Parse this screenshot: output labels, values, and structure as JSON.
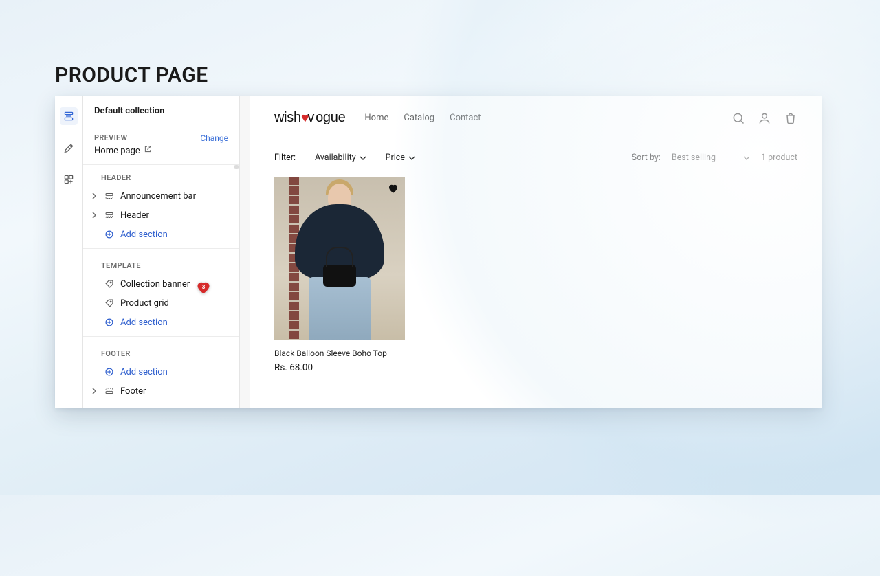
{
  "page_heading": "PRODUCT PAGE",
  "sidebar": {
    "title": "Default collection",
    "preview_label": "PREVIEW",
    "change_label": "Change",
    "home_page_label": "Home page",
    "groups": {
      "header": {
        "label": "HEADER",
        "items": [
          "Announcement bar",
          "Header"
        ],
        "add": "Add section"
      },
      "template": {
        "label": "TEMPLATE",
        "items": [
          "Collection banner",
          "Product grid"
        ],
        "add": "Add section"
      },
      "footer": {
        "label": "FOOTER",
        "add": "Add section",
        "items": [
          "Footer"
        ]
      }
    }
  },
  "store": {
    "logo_part1": "wish",
    "logo_part2": "ogue",
    "nav": {
      "home": "Home",
      "catalog": "Catalog",
      "contact": "Contact"
    },
    "filter": {
      "label": "Filter:",
      "availability": "Availability",
      "price": "Price",
      "sort_label": "Sort by:",
      "sort_value": "Best selling",
      "count": "1 product"
    },
    "product": {
      "name": "Black Balloon Sleeve Boho Top",
      "price": "Rs. 68.00"
    }
  },
  "wishlist_badge": "3"
}
